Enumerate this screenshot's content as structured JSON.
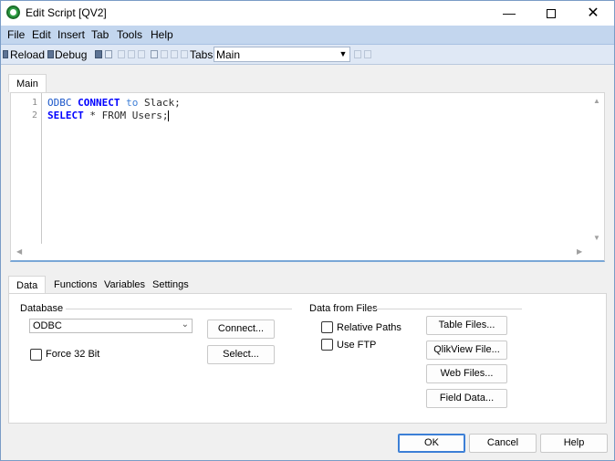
{
  "window": {
    "title": "Edit Script [QV2]",
    "controls": {
      "minimize": "—",
      "close": "✕"
    }
  },
  "menu": [
    "File",
    "Edit",
    "Insert",
    "Tab",
    "Tools",
    "Help"
  ],
  "toolbar": {
    "reload_label": "Reload",
    "debug_label": "Debug",
    "tabs_label": "Tabs",
    "tabs_value": "Main"
  },
  "editor": {
    "tab_label": "Main",
    "lines": [
      {
        "no": "1",
        "parts": [
          {
            "text": "ODBC ",
            "cls": "kw-odbc"
          },
          {
            "text": "CONNECT",
            "cls": "kw"
          },
          {
            "text": " to ",
            "cls": "kw-light"
          },
          {
            "text": "Slack;",
            "cls": ""
          }
        ]
      },
      {
        "no": "2",
        "parts": [
          {
            "text": "SELECT",
            "cls": "kw"
          },
          {
            "text": " * FROM Users;",
            "cls": ""
          }
        ]
      }
    ]
  },
  "bottom_tabs": [
    "Data",
    "Functions",
    "Variables",
    "Settings"
  ],
  "data_panel": {
    "database_group": "Database",
    "database_value": "ODBC",
    "force32_label": "Force 32 Bit",
    "connect_label": "Connect...",
    "select_label": "Select...",
    "files_group": "Data from Files",
    "relative_paths_label": "Relative Paths",
    "use_ftp_label": "Use FTP",
    "table_files_label": "Table Files...",
    "qlikview_file_label": "QlikView File...",
    "web_files_label": "Web Files...",
    "field_data_label": "Field Data..."
  },
  "footer": {
    "ok": "OK",
    "cancel": "Cancel",
    "help": "Help"
  }
}
